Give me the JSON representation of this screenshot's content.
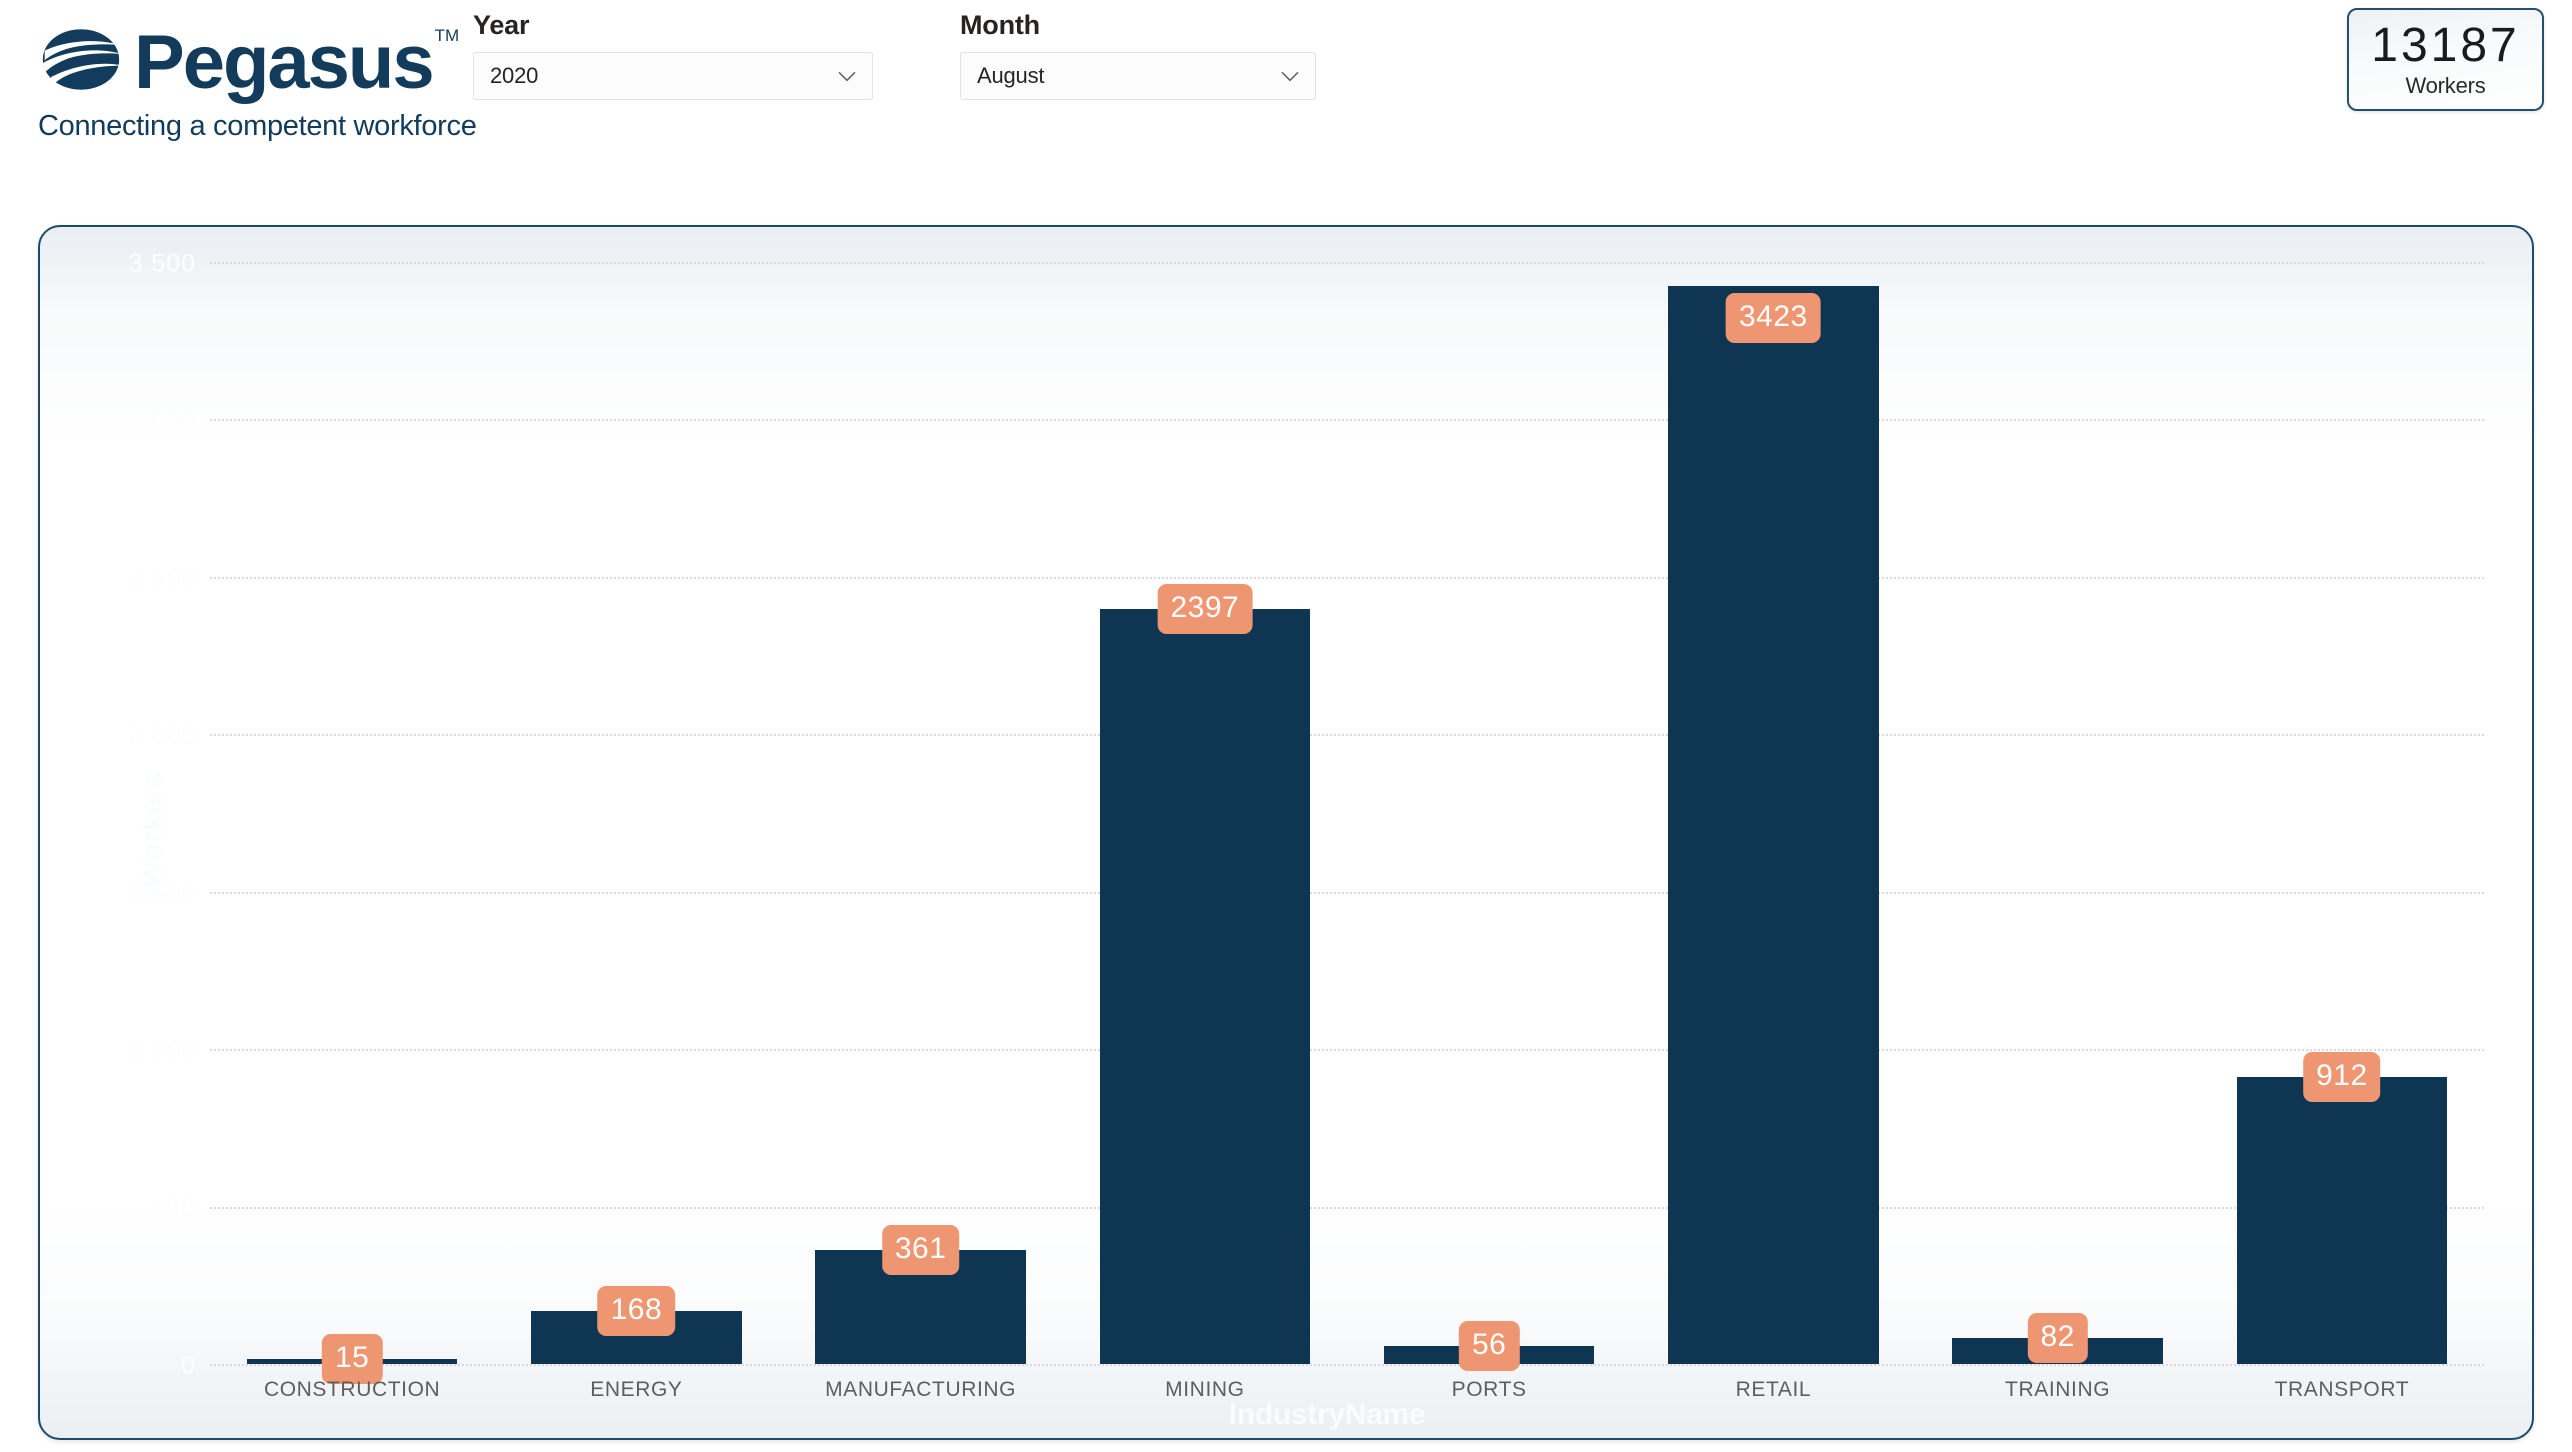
{
  "brand": {
    "name": "Pegasus",
    "trademark": "TM",
    "tagline": "Connecting a competent workforce",
    "color": "#123B5C"
  },
  "filters": [
    {
      "label": "Year",
      "value": "2020",
      "icon": "chevron-down-icon"
    },
    {
      "label": "Month",
      "value": "August",
      "icon": "chevron-down-icon"
    }
  ],
  "kpi": {
    "value": "13187",
    "label": "Workers",
    "border_color": "#23506E"
  },
  "chart_data": {
    "type": "bar",
    "title": "",
    "xlabel": "IndustryName",
    "ylabel": "#Workers",
    "categories": [
      "CONSTRUCTION",
      "ENERGY",
      "MANUFACTURING",
      "MINING",
      "PORTS",
      "RETAIL",
      "TRAINING",
      "TRANSPORT"
    ],
    "values": [
      15,
      168,
      361,
      2397,
      56,
      3423,
      82,
      912
    ],
    "value_labels": [
      "15",
      "168",
      "361",
      "2397",
      "56",
      "3423",
      "82",
      "912"
    ],
    "ylim": [
      0,
      3500
    ],
    "yticks": [
      3500,
      3000,
      2500,
      2000,
      1500,
      1000,
      500,
      0
    ],
    "ytick_labels": [
      "3 500",
      "3 000",
      "2 500",
      "2 000",
      "1 500",
      "1 000",
      "500",
      "0"
    ],
    "grid": true,
    "legend": "none",
    "bar_color": "#0E3552",
    "label_bg_color": "#EE9672",
    "label_text_color": "#FFFFFF",
    "gridline_color": "#D9D9D9"
  }
}
